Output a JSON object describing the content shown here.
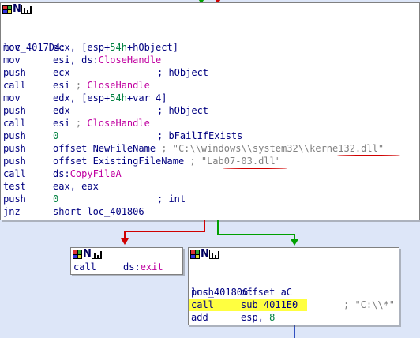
{
  "colors": {
    "background": "#dde6f8",
    "code_text": "#000080",
    "comment": "#808080",
    "string": "#2a7a2a",
    "import": "#c000a0",
    "number": "#008040",
    "highlight": "#ffff40",
    "edge_true": "#00a000",
    "edge_false": "#d00000",
    "annotation": "#d00000"
  },
  "main_node": {
    "label": "loc_4017D4:",
    "lines": [
      {
        "mn": "mov",
        "parts": [
          {
            "t": "ecx, [esp+"
          },
          {
            "t": "54h",
            "c": "num"
          },
          {
            "t": "+hObject]"
          }
        ]
      },
      {
        "mn": "mov",
        "parts": [
          {
            "t": "esi, ds:"
          },
          {
            "t": "CloseHandle",
            "c": "func"
          }
        ]
      },
      {
        "mn": "push",
        "parts": [
          {
            "t": "ecx"
          }
        ],
        "cm": "; hObject",
        "cmx": 198
      },
      {
        "mn": "call",
        "parts": [
          {
            "t": "esi "
          },
          {
            "t": "; ",
            "c": "cmt"
          },
          {
            "t": "CloseHandle",
            "c": "func"
          }
        ]
      },
      {
        "mn": "mov",
        "parts": [
          {
            "t": "edx, [esp+"
          },
          {
            "t": "54h",
            "c": "num"
          },
          {
            "t": "+var_4]"
          }
        ]
      },
      {
        "mn": "push",
        "parts": [
          {
            "t": "edx"
          }
        ],
        "cm": "; hObject",
        "cmx": 198
      },
      {
        "mn": "call",
        "parts": [
          {
            "t": "esi "
          },
          {
            "t": "; ",
            "c": "cmt"
          },
          {
            "t": "CloseHandle",
            "c": "func"
          }
        ]
      },
      {
        "mn": "push",
        "parts": [
          {
            "t": "0",
            "c": "num"
          }
        ],
        "cm": "; bFailIfExists",
        "cmx": 198
      },
      {
        "mn": "push",
        "parts": [
          {
            "t": "offset NewFileName "
          },
          {
            "t": "; \"C:\\\\windows\\\\system32\\\\kerne132.dll\"",
            "c": "cmt"
          }
        ]
      },
      {
        "mn": "push",
        "parts": [
          {
            "t": "offset ExistingFileName "
          },
          {
            "t": "; \"Lab07-03.dll\"",
            "c": "cmt"
          }
        ]
      },
      {
        "mn": "call",
        "parts": [
          {
            "t": "ds:"
          },
          {
            "t": "CopyFileA",
            "c": "func"
          }
        ]
      },
      {
        "mn": "test",
        "parts": [
          {
            "t": "eax, eax"
          }
        ]
      },
      {
        "mn": "push",
        "parts": [
          {
            "t": "0",
            "c": "num"
          }
        ],
        "cm": "; int",
        "cmx": 198
      },
      {
        "mn": "jnz",
        "parts": [
          {
            "t": "short loc_401806"
          }
        ]
      }
    ]
  },
  "exit_node": {
    "lines": [
      {
        "mn": "call",
        "parts": [
          {
            "t": "ds:"
          },
          {
            "t": "exit",
            "c": "func"
          }
        ]
      }
    ]
  },
  "loc_node": {
    "label": "loc_401806:",
    "label_comment": "; \"C:\\\\*\"",
    "lines": [
      {
        "mn": "push",
        "parts": [
          {
            "t": "offset aC"
          }
        ]
      },
      {
        "mn": "call",
        "parts": [
          {
            "t": "sub_4011E0"
          }
        ],
        "highlight": true
      },
      {
        "mn": "add",
        "parts": [
          {
            "t": "esp, "
          },
          {
            "t": "8",
            "c": "num"
          }
        ]
      }
    ]
  }
}
